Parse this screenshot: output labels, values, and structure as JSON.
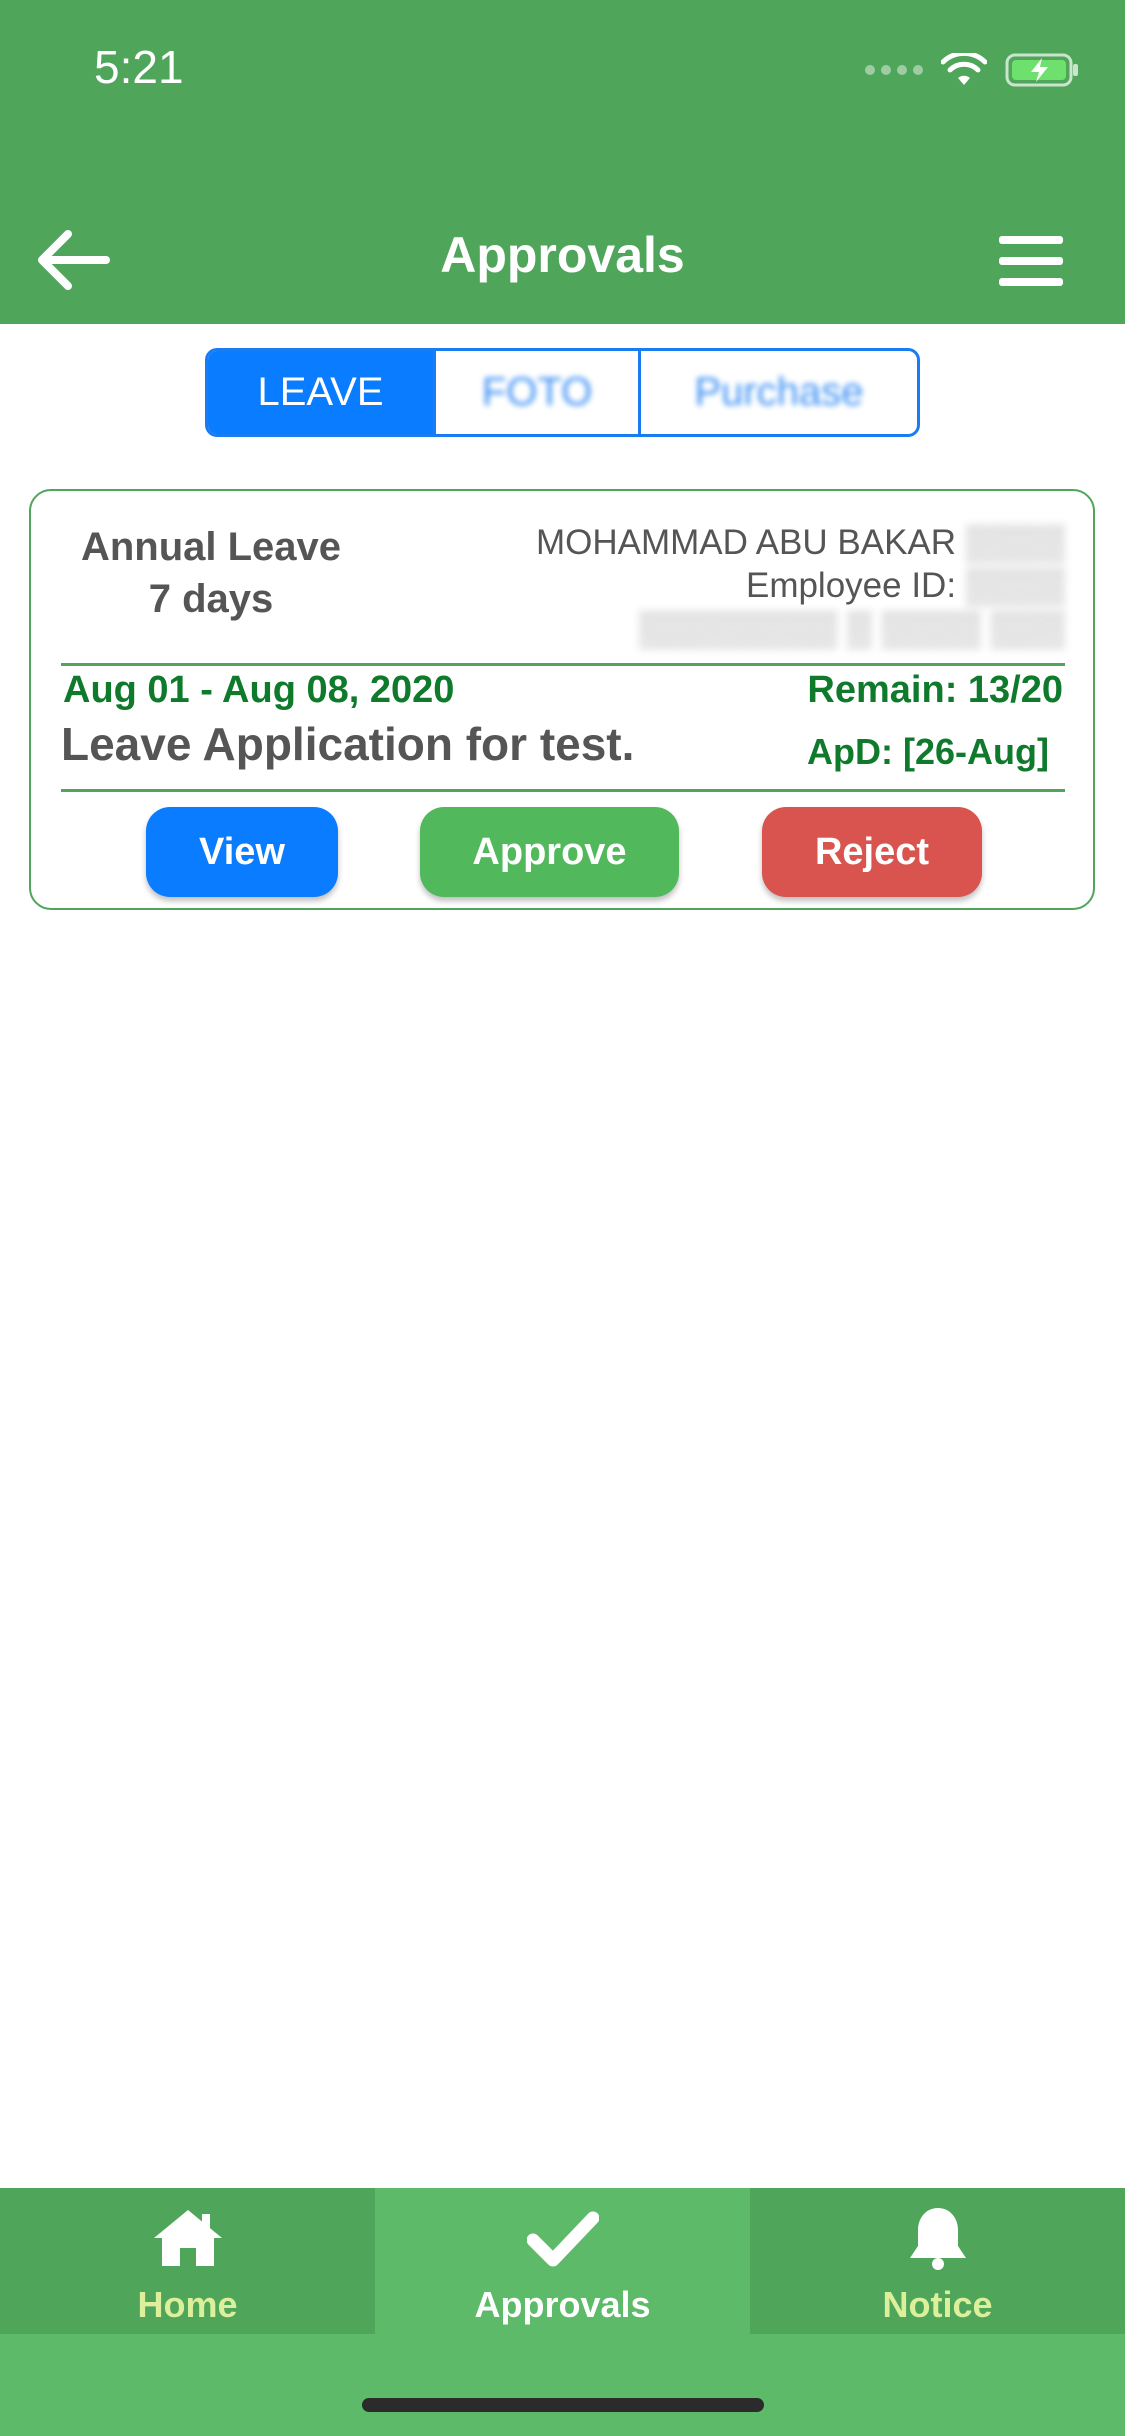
{
  "status_bar": {
    "time": "5:21"
  },
  "nav": {
    "title": "Approvals"
  },
  "segments": [
    {
      "label": "LEAVE",
      "active": true
    },
    {
      "label": "FOTO",
      "active": false
    },
    {
      "label": "Purchase",
      "active": false
    }
  ],
  "card": {
    "leave_type": "Annual Leave",
    "duration": "7 days",
    "employee_name": "MOHAMMAD ABU BAKAR",
    "employee_id_label": "Employee ID:",
    "date_range": "Aug 01 - Aug 08, 2020",
    "remain": "Remain: 13/20",
    "reason": "Leave Application for test.",
    "apd": "ApD: [26-Aug]",
    "buttons": {
      "view": "View",
      "approve": "Approve",
      "reject": "Reject"
    }
  },
  "tabbar": {
    "items": [
      {
        "label": "Home",
        "icon": "home-icon",
        "active": false
      },
      {
        "label": "Approvals",
        "icon": "check-icon",
        "active": true
      },
      {
        "label": "Notice",
        "icon": "bell-icon",
        "active": false
      }
    ]
  },
  "colors": {
    "header_green": "#4fa55a",
    "primary_blue": "#0a7cff",
    "approve_green": "#52b85c",
    "reject_red": "#d9534f",
    "text_green": "#0f7a2c",
    "tab_label_inactive": "#dcef9a"
  }
}
